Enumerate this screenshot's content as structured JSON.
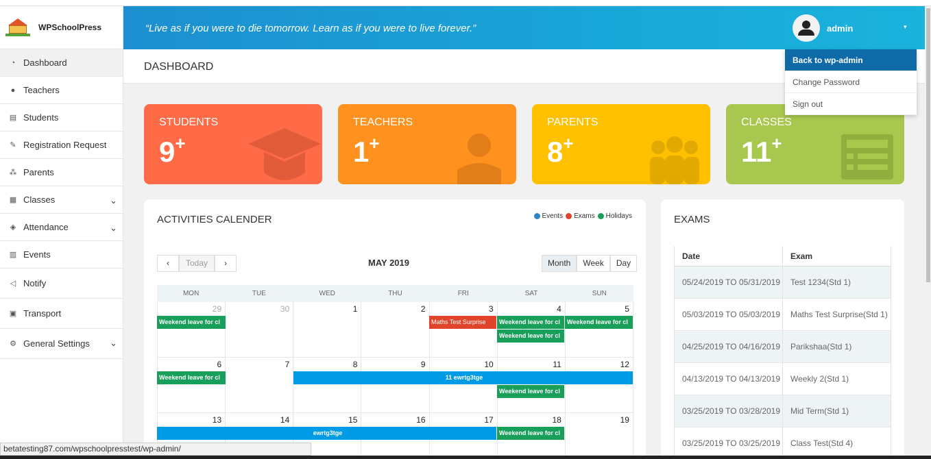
{
  "brand": {
    "name": "WPSchoolPress"
  },
  "header": {
    "quote": "“Live as if you were to die tomorrow. Learn as if you were to live forever.”",
    "username": "admin"
  },
  "user_menu": {
    "items": [
      "Back to wp-admin",
      "Change Password",
      "Sign out"
    ]
  },
  "sidebar": {
    "items": [
      {
        "label": "Dashboard",
        "icon": "dashboard-icon"
      },
      {
        "label": "Teachers",
        "icon": "teacher-icon"
      },
      {
        "label": "Students",
        "icon": "student-icon"
      },
      {
        "label": "Registration Request",
        "icon": "edit-icon"
      },
      {
        "label": "Parents",
        "icon": "parents-icon"
      },
      {
        "label": "Classes",
        "icon": "classes-icon"
      },
      {
        "label": "Attendance",
        "icon": "attendance-icon"
      },
      {
        "label": "Events",
        "icon": "calendar-icon"
      },
      {
        "label": "Notify",
        "icon": "megaphone-icon"
      },
      {
        "label": "Transport",
        "icon": "bus-icon"
      },
      {
        "label": "General Settings",
        "icon": "gear-icon"
      }
    ]
  },
  "page": {
    "title": "DASHBOARD"
  },
  "stats": [
    {
      "label": "STUDENTS",
      "value": "9",
      "sup": "+",
      "color": "#ff6b47"
    },
    {
      "label": "TEACHERS",
      "value": "1",
      "sup": "+",
      "color": "#ff921e"
    },
    {
      "label": "PARENTS",
      "value": "8",
      "sup": "+",
      "color": "#ffc000"
    },
    {
      "label": "CLASSES",
      "value": "11",
      "sup": "+",
      "color": "#a8c74e"
    }
  ],
  "calendar": {
    "title": "ACTIVITIES CALENDER",
    "legend": [
      {
        "label": "Events",
        "color": "#2e86c1"
      },
      {
        "label": "Exams",
        "color": "#e0452c"
      },
      {
        "label": "Holidays",
        "color": "#18a05a"
      }
    ],
    "today_label": "Today",
    "month_label": "MAY 2019",
    "views": [
      "Month",
      "Week",
      "Day"
    ],
    "days_of_week": [
      "MON",
      "TUE",
      "WED",
      "THU",
      "FRI",
      "SAT",
      "SUN"
    ],
    "weeks": [
      [
        "29",
        "30",
        "1",
        "2",
        "3",
        "4",
        "5"
      ],
      [
        "6",
        "7",
        "8",
        "9",
        "10",
        "11",
        "12"
      ],
      [
        "13",
        "14",
        "15",
        "16",
        "17",
        "18",
        "19"
      ]
    ],
    "events": {
      "weekend_leave": "Weekend leave for cl",
      "maths_test": "Maths Test Surprise",
      "ewrtg_timed": "11 ewrtg3tge",
      "ewrtg": "ewrtg3tge"
    }
  },
  "exams": {
    "title": "EXAMS",
    "headers": [
      "Date",
      "Exam"
    ],
    "rows": [
      {
        "date": "05/24/2019 TO 05/31/2019",
        "exam": "Test 1234(Std 1)"
      },
      {
        "date": "05/03/2019 TO 05/03/2019",
        "exam": "Maths Test Surprise(Std 1)"
      },
      {
        "date": "04/25/2019 TO 04/16/2019",
        "exam": "Parikshaa(Std 1)"
      },
      {
        "date": "04/13/2019 TO 04/13/2019",
        "exam": "Weekly 2(Std 1)"
      },
      {
        "date": "03/25/2019 TO 03/28/2019",
        "exam": "Mid Term(Std 1)"
      },
      {
        "date": "03/25/2019 TO 03/25/2019",
        "exam": "Class Test(Std 4)"
      }
    ]
  },
  "statusbar": {
    "url": "betatesting87.com/wpschoolpresstest/wp-admin/"
  }
}
